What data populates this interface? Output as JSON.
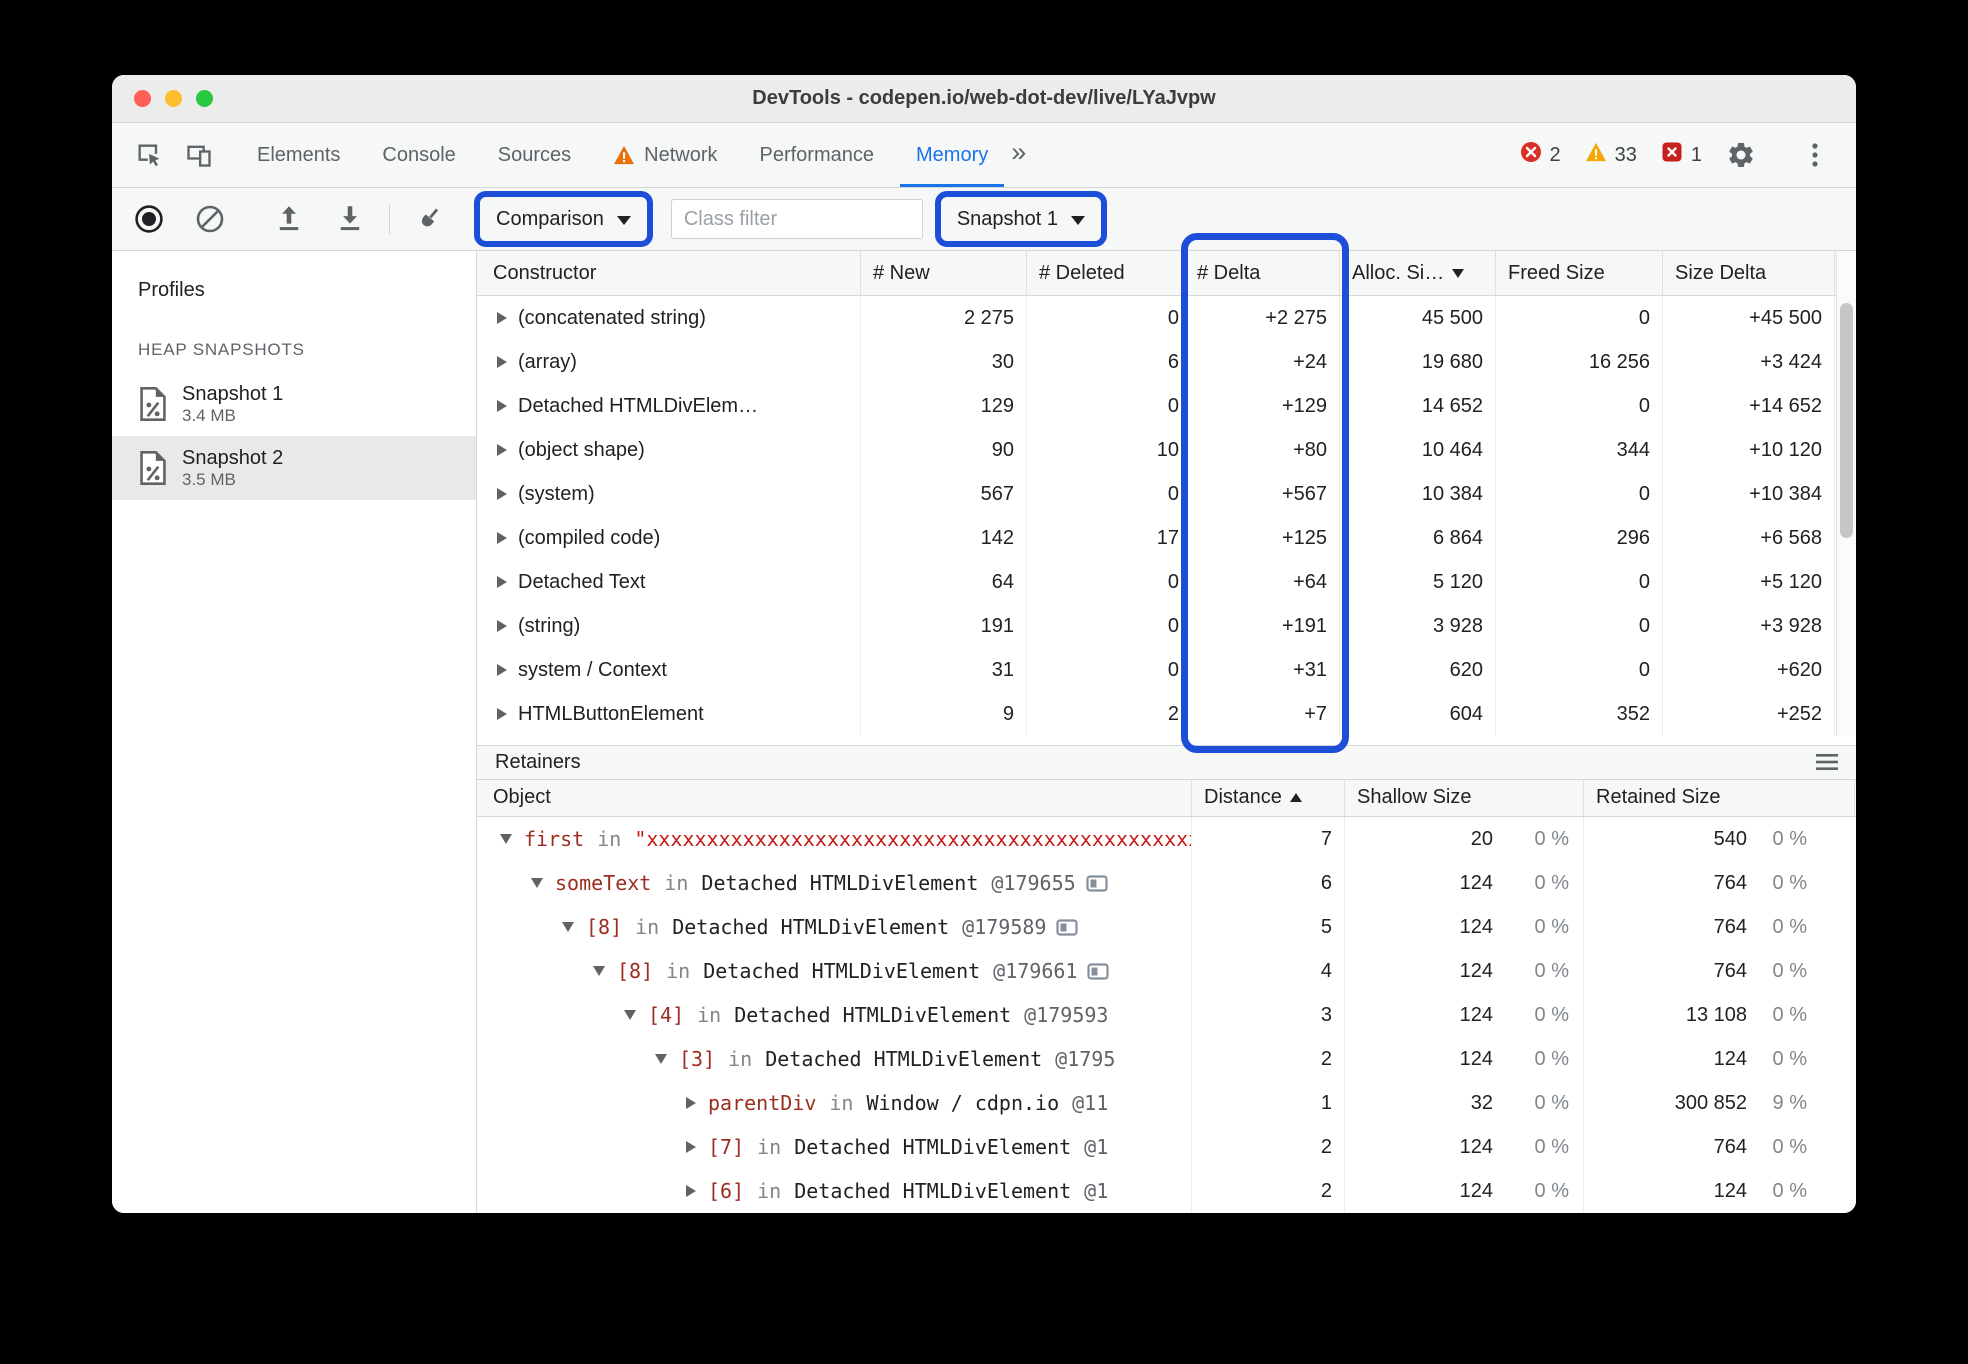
{
  "window": {
    "title": "DevTools - codepen.io/web-dot-dev/live/LYaJvpw"
  },
  "colors": {
    "annotation_blue": "#1d4ed8",
    "active_tab_blue": "#1a73e8",
    "error_red": "#d93025",
    "warning_orange": "#e8710a",
    "issue_red": "#c5221f"
  },
  "tabbar": {
    "tabs": [
      {
        "label": "Elements"
      },
      {
        "label": "Console"
      },
      {
        "label": "Sources"
      },
      {
        "label": "Network",
        "warning": true
      },
      {
        "label": "Performance"
      },
      {
        "label": "Memory",
        "active": true
      }
    ],
    "more_tabs": "»",
    "error_count": "2",
    "warning_count": "33",
    "issue_count": "1"
  },
  "toolbar": {
    "comparison": {
      "label": "Comparison"
    },
    "class_filter": {
      "placeholder": "Class filter"
    },
    "snapshot": {
      "label": "Snapshot 1"
    }
  },
  "sidebar": {
    "profiles_label": "Profiles",
    "section_label": "HEAP SNAPSHOTS",
    "snapshots": [
      {
        "name": "Snapshot 1",
        "size": "3.4 MB",
        "selected": false
      },
      {
        "name": "Snapshot 2",
        "size": "3.5 MB",
        "selected": true
      }
    ]
  },
  "constructors": {
    "columns": [
      {
        "label": "Constructor"
      },
      {
        "label": "# New"
      },
      {
        "label": "# Deleted"
      },
      {
        "label": "# Delta"
      },
      {
        "label": "Alloc. Si…",
        "sort": "desc"
      },
      {
        "label": "Freed Size"
      },
      {
        "label": "Size Delta"
      }
    ],
    "rows": [
      {
        "name": "(concatenated string)",
        "new": "2 275",
        "deleted": "0",
        "delta": "+2 275",
        "alloc": "45 500",
        "freed": "0",
        "size_delta": "+45 500"
      },
      {
        "name": "(array)",
        "new": "30",
        "deleted": "6",
        "delta": "+24",
        "alloc": "19 680",
        "freed": "16 256",
        "size_delta": "+3 424"
      },
      {
        "name": "Detached HTMLDivElem…",
        "new": "129",
        "deleted": "0",
        "delta": "+129",
        "alloc": "14 652",
        "freed": "0",
        "size_delta": "+14 652"
      },
      {
        "name": "(object shape)",
        "new": "90",
        "deleted": "10",
        "delta": "+80",
        "alloc": "10 464",
        "freed": "344",
        "size_delta": "+10 120"
      },
      {
        "name": "(system)",
        "new": "567",
        "deleted": "0",
        "delta": "+567",
        "alloc": "10 384",
        "freed": "0",
        "size_delta": "+10 384"
      },
      {
        "name": "(compiled code)",
        "new": "142",
        "deleted": "17",
        "delta": "+125",
        "alloc": "6 864",
        "freed": "296",
        "size_delta": "+6 568"
      },
      {
        "name": "Detached Text",
        "new": "64",
        "deleted": "0",
        "delta": "+64",
        "alloc": "5 120",
        "freed": "0",
        "size_delta": "+5 120"
      },
      {
        "name": "(string)",
        "new": "191",
        "deleted": "0",
        "delta": "+191",
        "alloc": "3 928",
        "freed": "0",
        "size_delta": "+3 928"
      },
      {
        "name": "system / Context",
        "new": "31",
        "deleted": "0",
        "delta": "+31",
        "alloc": "620",
        "freed": "0",
        "size_delta": "+620"
      },
      {
        "name": "HTMLButtonElement",
        "new": "9",
        "deleted": "2",
        "delta": "+7",
        "alloc": "604",
        "freed": "352",
        "size_delta": "+252"
      }
    ]
  },
  "retainers": {
    "title": "Retainers",
    "in_keyword": "in",
    "columns": [
      {
        "label": "Object"
      },
      {
        "label": "Distance",
        "sort": "asc"
      },
      {
        "label": "Shallow Size"
      },
      {
        "label": "Retained Size"
      }
    ],
    "rows": [
      {
        "level": 0,
        "expanded": true,
        "name": "first",
        "target": "\"xxxxxxxxxxxxxxxxxxxxxxxxxxxxxxxxxxxxxxxxxxxxxxxxxxxxxxxx",
        "target_type": "string",
        "id": "",
        "icon": false,
        "distance": "7",
        "shallow": "20",
        "shallow_pct": "0 %",
        "retained": "540",
        "retained_pct": "0 %"
      },
      {
        "level": 1,
        "expanded": true,
        "name": "someText",
        "target": "Detached HTMLDivElement",
        "id": "@179655",
        "icon": true,
        "distance": "6",
        "shallow": "124",
        "shallow_pct": "0 %",
        "retained": "764",
        "retained_pct": "0 %"
      },
      {
        "level": 2,
        "expanded": true,
        "name": "[8]",
        "target": "Detached HTMLDivElement",
        "id": "@179589",
        "icon": true,
        "distance": "5",
        "shallow": "124",
        "shallow_pct": "0 %",
        "retained": "764",
        "retained_pct": "0 %"
      },
      {
        "level": 3,
        "expanded": true,
        "name": "[8]",
        "target": "Detached HTMLDivElement",
        "id": "@179661",
        "icon": true,
        "distance": "4",
        "shallow": "124",
        "shallow_pct": "0 %",
        "retained": "764",
        "retained_pct": "0 %"
      },
      {
        "level": 4,
        "expanded": true,
        "name": "[4]",
        "target": "Detached HTMLDivElement",
        "id": "@179593",
        "icon": false,
        "distance": "3",
        "shallow": "124",
        "shallow_pct": "0 %",
        "retained": "13 108",
        "retained_pct": "0 %"
      },
      {
        "level": 5,
        "expanded": true,
        "name": "[3]",
        "target": "Detached HTMLDivElement",
        "id": "@1795",
        "icon": false,
        "distance": "2",
        "shallow": "124",
        "shallow_pct": "0 %",
        "retained": "124",
        "retained_pct": "0 %"
      },
      {
        "level": 6,
        "expanded": false,
        "name": "parentDiv",
        "target": "Window / cdpn.io",
        "id": "@11",
        "icon": false,
        "distance": "1",
        "shallow": "32",
        "shallow_pct": "0 %",
        "retained": "300 852",
        "retained_pct": "9 %"
      },
      {
        "level": 6,
        "expanded": false,
        "name": "[7]",
        "target": "Detached HTMLDivElement",
        "id": "@1",
        "icon": false,
        "distance": "2",
        "shallow": "124",
        "shallow_pct": "0 %",
        "retained": "764",
        "retained_pct": "0 %"
      },
      {
        "level": 6,
        "expanded": false,
        "name": "[6]",
        "target": "Detached HTMLDivElement",
        "id": "@1",
        "icon": false,
        "distance": "2",
        "shallow": "124",
        "shallow_pct": "0 %",
        "retained": "124",
        "retained_pct": "0 %"
      }
    ]
  }
}
